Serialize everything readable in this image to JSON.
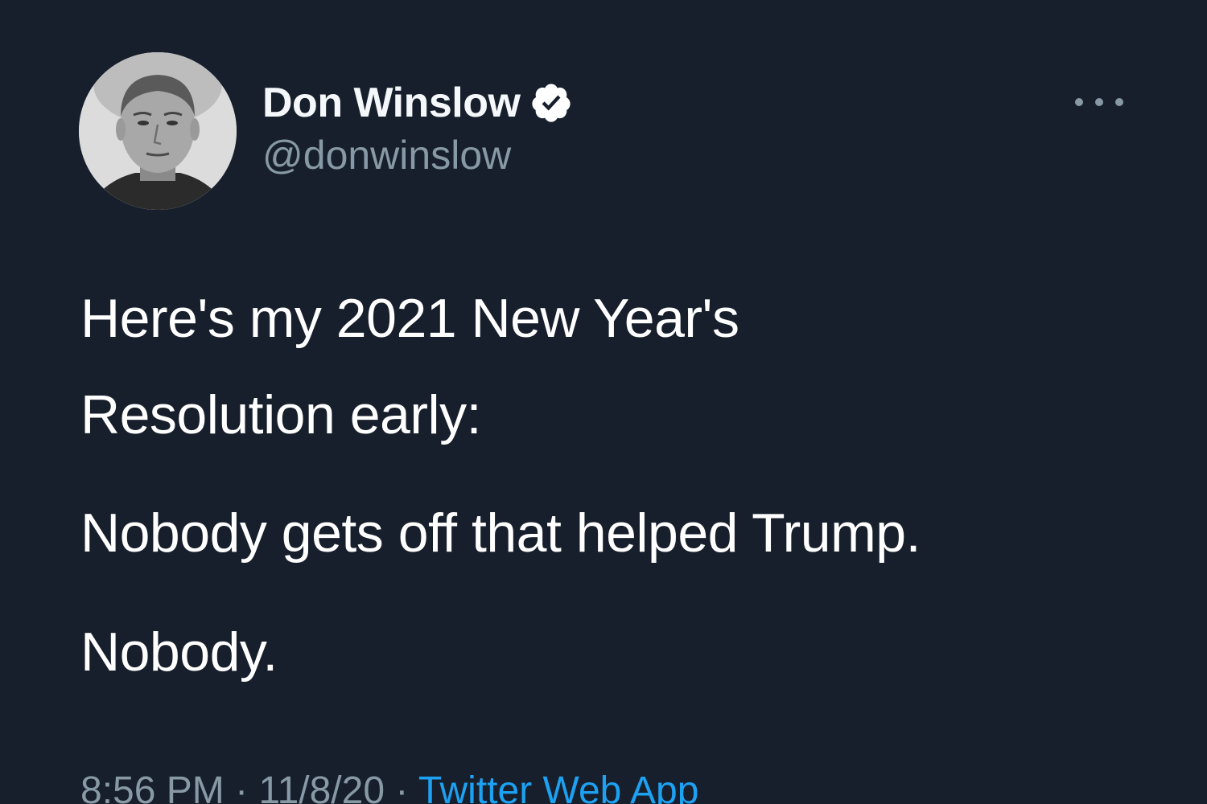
{
  "tweet": {
    "author": {
      "display_name": "Don Winslow",
      "handle": "@donwinslow",
      "verified_icon": "verified-badge-icon",
      "avatar": "author-avatar"
    },
    "more_icon": "more-options-icon",
    "text_lines": {
      "line1": "Here's my 2021 New Year's",
      "line2": "Resolution early:",
      "line3": "Nobody gets off that helped Trump.",
      "line4": "Nobody."
    },
    "meta": {
      "time": "8:56 PM",
      "separator": "·",
      "date": "11/8/20",
      "source": "Twitter Web App"
    }
  },
  "colors": {
    "background": "#171f2c",
    "text": "#ffffff",
    "secondary_text": "#8899a6",
    "link": "#1da1f2"
  }
}
